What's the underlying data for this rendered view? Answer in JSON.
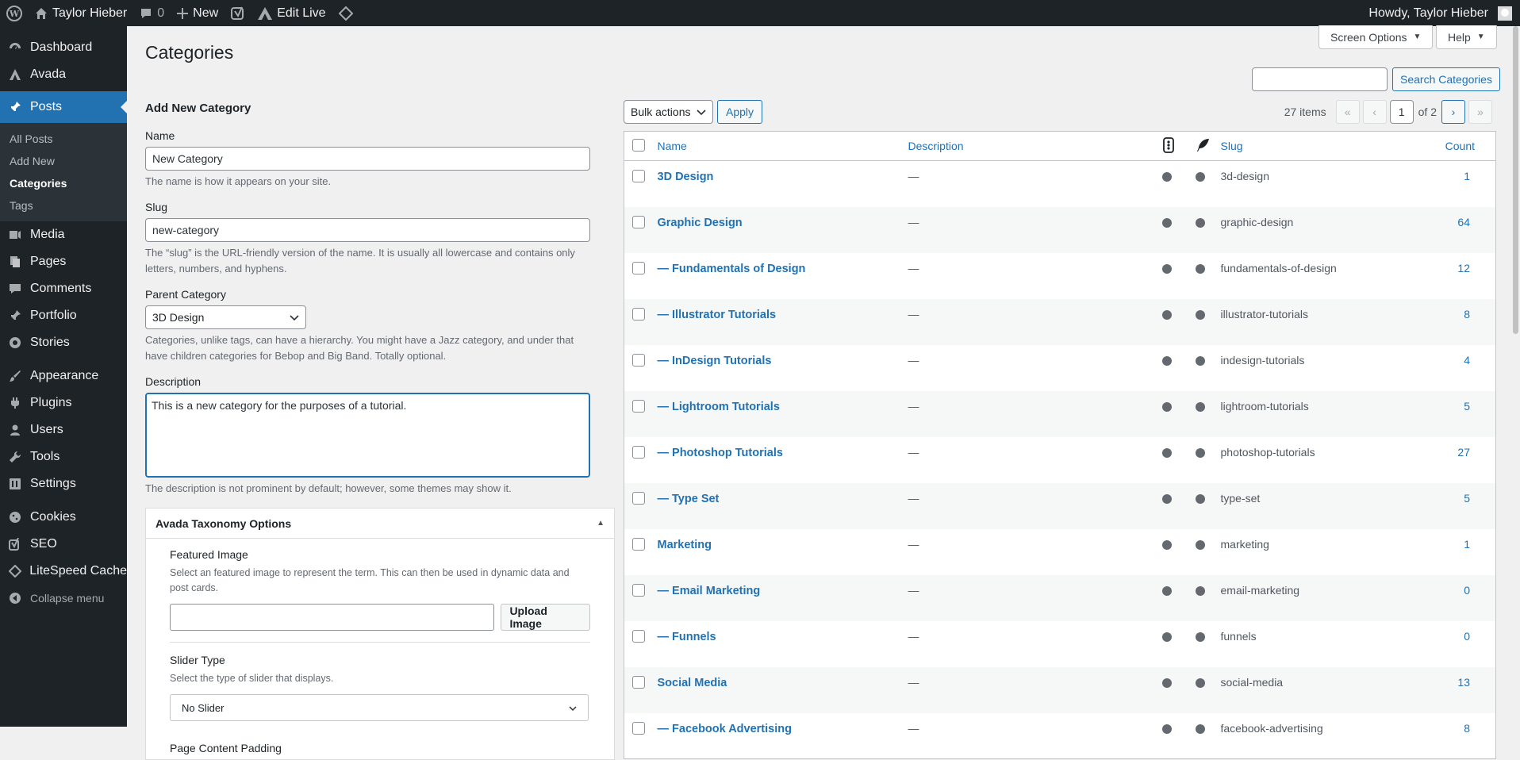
{
  "admin_bar": {
    "site_name": "Taylor Hieber",
    "comments_count": "0",
    "new_label": "New",
    "edit_live_label": "Edit Live",
    "howdy": "Howdy, Taylor Hieber"
  },
  "sidebar": {
    "items": [
      {
        "label": "Dashboard",
        "icon": "dashboard-icon"
      },
      {
        "label": "Avada",
        "icon": "avada-icon"
      },
      {
        "label": "Posts",
        "icon": "pin-icon"
      },
      {
        "label": "Media",
        "icon": "media-icon"
      },
      {
        "label": "Pages",
        "icon": "pages-icon"
      },
      {
        "label": "Comments",
        "icon": "comment-icon"
      },
      {
        "label": "Portfolio",
        "icon": "pin-icon"
      },
      {
        "label": "Stories",
        "icon": "stories-icon"
      },
      {
        "label": "Appearance",
        "icon": "brush-icon"
      },
      {
        "label": "Plugins",
        "icon": "plugin-icon"
      },
      {
        "label": "Users",
        "icon": "user-icon"
      },
      {
        "label": "Tools",
        "icon": "wrench-icon"
      },
      {
        "label": "Settings",
        "icon": "settings-icon"
      },
      {
        "label": "Cookies",
        "icon": "cookie-icon"
      },
      {
        "label": "SEO",
        "icon": "yoast-icon"
      },
      {
        "label": "LiteSpeed Cache",
        "icon": "diamond-icon"
      },
      {
        "label": "Collapse menu",
        "icon": "collapse-icon"
      }
    ],
    "posts_sub": [
      "All Posts",
      "Add New",
      "Categories",
      "Tags"
    ]
  },
  "page": {
    "title": "Categories",
    "screen_options": "Screen Options",
    "help": "Help"
  },
  "form": {
    "heading": "Add New Category",
    "name_label": "Name",
    "name_value": "New Category",
    "name_hint": "The name is how it appears on your site.",
    "slug_label": "Slug",
    "slug_value": "new-category",
    "slug_hint": "The “slug” is the URL-friendly version of the name. It is usually all lowercase and contains only letters, numbers, and hyphens.",
    "parent_label": "Parent Category",
    "parent_value": "3D Design",
    "parent_hint": "Categories, unlike tags, can have a hierarchy. You might have a Jazz category, and under that have children categories for Bebop and Big Band. Totally optional.",
    "desc_label": "Description",
    "desc_value": "This is a new category for the purposes of a tutorial.",
    "desc_hint": "The description is not prominent by default; however, some themes may show it."
  },
  "avada_panel": {
    "title": "Avada Taxonomy Options",
    "featured_label": "Featured Image",
    "featured_hint": "Select an featured image to represent the term. This can then be used in dynamic data and post cards.",
    "upload_label": "Upload Image",
    "slider_label": "Slider Type",
    "slider_hint": "Select the type of slider that displays.",
    "slider_value": "No Slider",
    "padding_label": "Page Content Padding"
  },
  "list": {
    "search_button": "Search Categories",
    "bulk_actions": "Bulk actions",
    "apply": "Apply",
    "items_count": "27 items",
    "current_page": "1",
    "of_pages": "of 2",
    "columns": {
      "name": "Name",
      "description": "Description",
      "slug": "Slug",
      "count": "Count"
    },
    "rows": [
      {
        "name": "3D Design",
        "desc": "—",
        "slug": "3d-design",
        "count": "1"
      },
      {
        "name": "Graphic Design",
        "desc": "—",
        "slug": "graphic-design",
        "count": "64"
      },
      {
        "name": "— Fundamentals of Design",
        "desc": "—",
        "slug": "fundamentals-of-design",
        "count": "12"
      },
      {
        "name": "— Illustrator Tutorials",
        "desc": "—",
        "slug": "illustrator-tutorials",
        "count": "8"
      },
      {
        "name": "— InDesign Tutorials",
        "desc": "—",
        "slug": "indesign-tutorials",
        "count": "4"
      },
      {
        "name": "— Lightroom Tutorials",
        "desc": "—",
        "slug": "lightroom-tutorials",
        "count": "5"
      },
      {
        "name": "— Photoshop Tutorials",
        "desc": "—",
        "slug": "photoshop-tutorials",
        "count": "27"
      },
      {
        "name": "— Type Set",
        "desc": "—",
        "slug": "type-set",
        "count": "5"
      },
      {
        "name": "Marketing",
        "desc": "—",
        "slug": "marketing",
        "count": "1"
      },
      {
        "name": "— Email Marketing",
        "desc": "—",
        "slug": "email-marketing",
        "count": "0"
      },
      {
        "name": "— Funnels",
        "desc": "—",
        "slug": "funnels",
        "count": "0"
      },
      {
        "name": "Social Media",
        "desc": "—",
        "slug": "social-media",
        "count": "13"
      },
      {
        "name": "— Facebook Advertising",
        "desc": "—",
        "slug": "facebook-advertising",
        "count": "8"
      }
    ]
  }
}
